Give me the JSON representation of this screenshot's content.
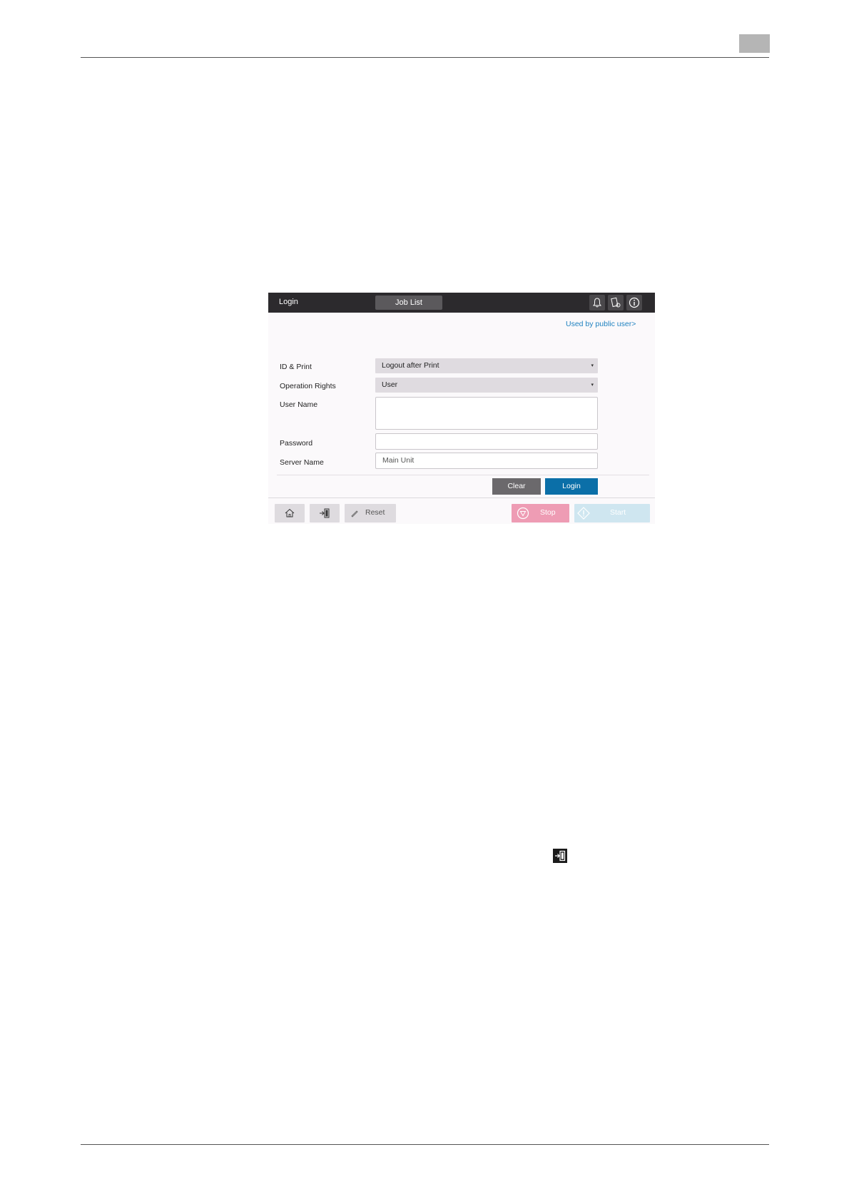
{
  "panel": {
    "title": "Login",
    "job_list_label": "Job List",
    "public_user_link": "Used by public user>",
    "fields": {
      "id_print": {
        "label": "ID & Print",
        "value": "Logout after Print"
      },
      "operation_rights": {
        "label": "Operation Rights",
        "value": "User"
      },
      "user_name": {
        "label": "User Name",
        "value": ""
      },
      "password": {
        "label": "Password",
        "value": ""
      },
      "server_name": {
        "label": "Server Name",
        "value": "Main Unit"
      }
    },
    "clear_label": "Clear",
    "login_label": "Login",
    "bottom": {
      "reset_label": "Reset",
      "stop_label": "Stop",
      "start_label": "Start"
    },
    "colors": {
      "titlebar": "#2c2a2d",
      "login_button": "#0b6fa8",
      "stop_button": "#ee9cb4",
      "start_button": "#cfe6f0",
      "link": "#1f82c0"
    }
  }
}
